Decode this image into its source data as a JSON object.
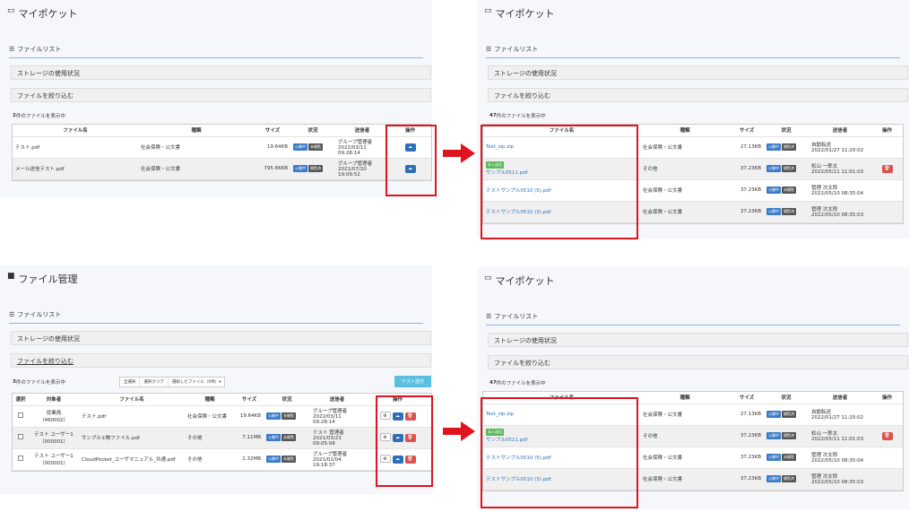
{
  "panels": {
    "tl": {
      "title": "マイポケット",
      "section": "ファイルリスト",
      "storage": "ストレージの使用状況",
      "filter": "ファイルを絞り込む",
      "count_num": "2",
      "count_text": "件のファイルを表示中",
      "headers": [
        "ファイル名",
        "種類",
        "サイズ",
        "状況",
        "送信者",
        "操作"
      ],
      "rows": [
        {
          "name": "テスト.pdf",
          "type": "社会保険・公文書",
          "size": "19.64KB",
          "sender": "グループ管理者",
          "date": "2022/03/11 09:28:14"
        },
        {
          "name": "メール送信テスト.pdf",
          "type": "社会保険・公文書",
          "size": "795.66KB",
          "sender": "グループ管理者",
          "date": "2021/07/20 19:09:52"
        }
      ]
    },
    "tr": {
      "title": "マイポケット",
      "section": "ファイルリスト",
      "storage": "ストレージの使用状況",
      "filter": "ファイルを絞り込む",
      "count_num": "47",
      "count_text": "件のファイルを表示中",
      "headers": [
        "ファイル名",
        "種類",
        "サイズ",
        "状況",
        "送信者",
        "操作"
      ],
      "rows": [
        {
          "name": "Test_zip.zip",
          "tag": "",
          "type": "社会保険・公文書",
          "size": "27.13KB",
          "sender": "自動転送",
          "date": "2022/01/27 11:20:02"
        },
        {
          "name": "サンプル0511.pdf",
          "tag": "本人送信",
          "type": "その他",
          "size": "37.23KB",
          "sender": "松山 一郎太",
          "date": "2022/05/11 11:01:03"
        },
        {
          "name": "テストサンプル0510 (5).pdf",
          "tag": "",
          "type": "社会保険・公文書",
          "size": "37.23KB",
          "sender": "管理 次太郎",
          "date": "2022/05/10 08:35:04"
        },
        {
          "name": "テストサンプル0510 (3).pdf",
          "tag": "",
          "type": "社会保険・公文書",
          "size": "37.23KB",
          "sender": "管理 次太郎",
          "date": "2022/05/10 08:35:03"
        }
      ]
    },
    "bl": {
      "title": "ファイル管理",
      "section": "ファイルリスト",
      "storage": "ストレージの使用状況",
      "filter": "ファイルを絞り込む",
      "count_num": "3",
      "count_text": "件のファイルを表示中",
      "toolbar": [
        "全選択",
        "選択クリア",
        "選択したファイル（0件）▾"
      ],
      "test_btn": "テスト送付",
      "headers": [
        "選択",
        "対象者",
        "ファイル名",
        "種類",
        "サイズ",
        "状況",
        "送信者",
        "操作"
      ],
      "rows": [
        {
          "target": "従業員",
          "tid": "（460002）",
          "name": "テスト.pdf",
          "type": "社会保険・公文書",
          "size": "19.64KB",
          "sender": "グループ管理者",
          "date": "2022/03/11 09:28:14"
        },
        {
          "target": "テスト ユーザー1",
          "tid": "（000001）",
          "name": "サンプル①物ファイル.pdf",
          "type": "その他",
          "size": "7.11MB",
          "sender": "テスト 管理者",
          "date": "2021/03/23 09:05:08"
        },
        {
          "target": "テスト ユーザー1",
          "tid": "（000001）",
          "name": "CloudPocket_ユーザマニュアル_共通.pdf",
          "type": "その他",
          "size": "1.32MB",
          "sender": "グループ管理者",
          "date": "2021/02/04 19:18:37"
        }
      ]
    },
    "br": {
      "title": "マイポケット",
      "section": "ファイルリスト",
      "storage": "ストレージの使用状況",
      "filter": "ファイルを絞り込む",
      "count_num": "47",
      "count_text": "件のファイルを表示中",
      "headers": [
        "ファイル名",
        "種類",
        "サイズ",
        "状況",
        "送信者",
        "操作"
      ],
      "rows": [
        {
          "name": "Test_zip.zip",
          "tag": "",
          "type": "社会保険・公文書",
          "size": "27.13KB",
          "sender": "自動転送",
          "date": "2022/01/27 11:20:02"
        },
        {
          "name": "サンプル0511.pdf",
          "tag": "本人送信",
          "type": "その他",
          "size": "37.23KB",
          "sender": "松山 一郎太",
          "date": "2022/05/11 11:01:03"
        },
        {
          "name": "テストサンプル0510 (5).pdf",
          "tag": "",
          "type": "社会保険・公文書",
          "size": "37.23KB",
          "sender": "管理 次太郎",
          "date": "2022/05/10 08:35:04"
        },
        {
          "name": "テストサンプル0510 (3).pdf",
          "tag": "",
          "type": "社会保険・公文書",
          "size": "37.23KB",
          "sender": "管理 次太郎",
          "date": "2022/05/10 08:35:03"
        }
      ]
    }
  },
  "badges": {
    "public": "公開中",
    "unread": "未開覧",
    "read": "開覧済"
  },
  "colors": {
    "highlight": "#e0141e",
    "accent": "#2f6fb7"
  }
}
